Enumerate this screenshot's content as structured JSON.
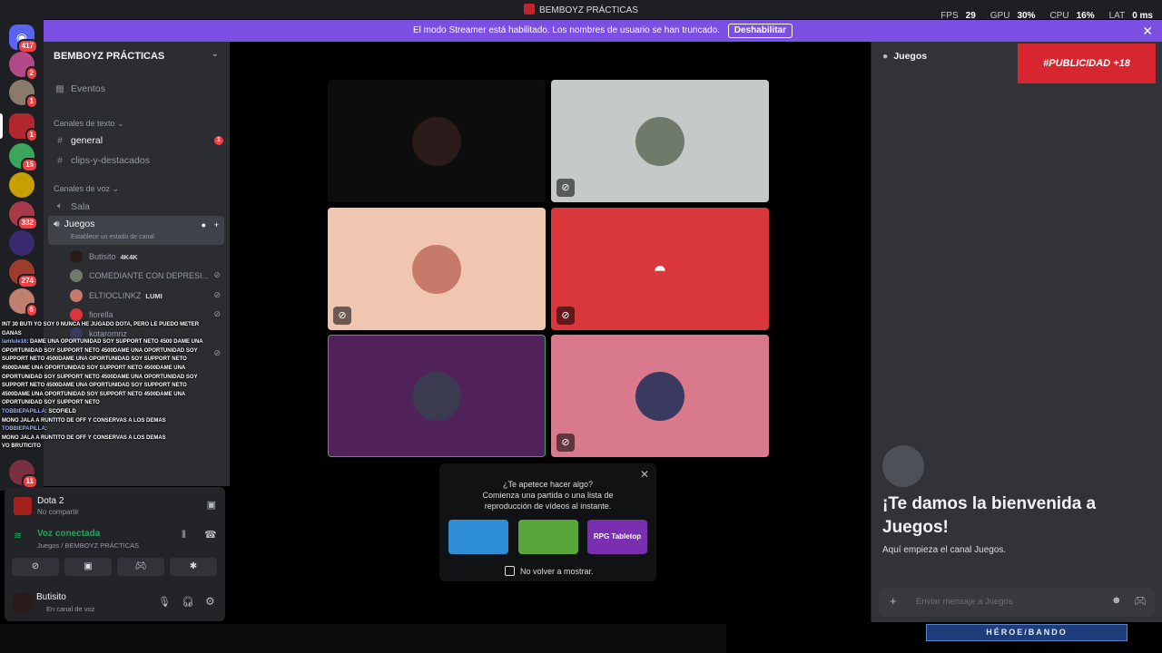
{
  "window": {
    "title": "BEMBOYZ PRÁCTICAS"
  },
  "stats": {
    "fps_label": "FPS",
    "fps": "29",
    "gpu_label": "GPU",
    "gpu": "30%",
    "cpu_label": "CPU",
    "cpu": "16%",
    "lat_label": "LAT",
    "lat": "0 ms"
  },
  "banner": {
    "text": "El modo Streamer está habilitado. Los nombres de usuario se han truncado.",
    "button": "Deshabilitar"
  },
  "rail": {
    "badges": [
      "417",
      "2",
      "1",
      "1",
      "15",
      "332",
      "274",
      "6",
      "11"
    ]
  },
  "sidebar": {
    "server_name": "BEMBOYZ PRÁCTICAS",
    "events": "Eventos",
    "text_category": "Canales de texto",
    "text_channels": [
      "general",
      "clips-y-destacados"
    ],
    "general_badge": "1",
    "voice_category": "Canales de voz",
    "voice_channels": [
      "Sala",
      "Juegos"
    ],
    "channel_status": "Establece un estado de canal",
    "members": [
      {
        "name": "Butisito",
        "tag": "4K4K"
      },
      {
        "name": "COMEDIANTE CON DEPRESI..."
      },
      {
        "name": "ELTIOCLINKZ",
        "tag": "LUMI"
      },
      {
        "name": "fiorella"
      },
      {
        "name": "kotaromnz"
      }
    ]
  },
  "chat_overlay": [
    {
      "nick": "",
      "text": "INT 30 BUTI YO SOY 0 NUNCA HE JUGADO DOTA, PERO LE PUEDO METER GANAS"
    },
    {
      "nick": "lamlule16",
      "text": ": DAME UNA OPORTUNIDAD SOY SUPPORT NETO 4500 DAME UNA OPORTUNIDAD SOY SUPPORT NETO 4500DAME UNA OPORTUNIDAD SOY SUPPORT NETO 4500DAME UNA OPORTUNIDAD SOY SUPPORT NETO 4500DAME UNA OPORTUNIDAD SOY SUPPORT NETO 4500DAME UNA OPORTUNIDAD SOY SUPPORT NETO 4500DAME UNA OPORTUNIDAD SOY SUPPORT NETO 4500DAME UNA OPORTUNIDAD SOY SUPPORT NETO 4500DAME UNA OPORTUNIDAD SOY SUPPORT NETO 4500DAME UNA OPORTUNIDAD SOY SUPPORT NETO"
    },
    {
      "nick": "TOBBIEPAPILLA",
      "text": ": SCOFIELD"
    },
    {
      "nick": "",
      "text": "MONO JALA A RUNTITO DE OFF Y CONSERVAS A LOS DEMAS"
    },
    {
      "nick": "TOBBIEPAPILLA",
      "text": ":"
    },
    {
      "nick": "",
      "text": "MONO JALA A RUNTITO DE OFF Y CONSERVAS A LOS DEMAS"
    },
    {
      "nick": "",
      "text": "VO BRUTICITO"
    }
  ],
  "panel": {
    "game_title": "Dota 2",
    "game_sub": "No compartir",
    "voice_title": "Voz conectada",
    "voice_sub": "Juegos / BEMBOYZ PRÁCTICAS",
    "user_name": "Butisito",
    "user_status": "En canal de voz"
  },
  "popup": {
    "line1": "¿Te apetece hacer algo?",
    "line2": "Comienza una partida o una lista de",
    "line3": "reproducción de vídeos al instante.",
    "activities": [
      "",
      "",
      "RPG Tabletop"
    ],
    "checkbox": "No volver a mostrar."
  },
  "right_panel": {
    "header": "Juegos",
    "ad": "#PUBLICIDAD +18",
    "welcome_title": "¡Te damos la bienvenida a Juegos!",
    "welcome_sub": "Aquí empieza el canal Juegos.",
    "placeholder": "Enviar mensaje a Juegos"
  },
  "footer": {
    "bando": "HÉROE/BANDO"
  },
  "colors": {
    "accent": "#7b4fe2",
    "red": "#f23f43",
    "green": "#23a55a",
    "discord_red": "#da373c"
  }
}
